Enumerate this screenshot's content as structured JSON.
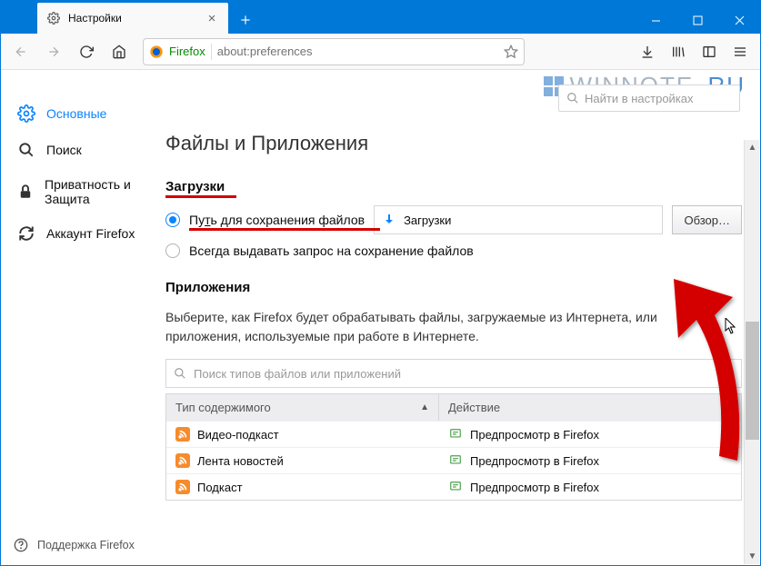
{
  "watermark": {
    "text1": "WINNOTE",
    "text2": ".RU"
  },
  "titlebar": {
    "tab_title": "Настройки",
    "tab_icon": "gear-icon",
    "close_icon": "close-icon",
    "newtab_icon": "plus-icon"
  },
  "window_controls": {
    "min": "—",
    "max": "▢",
    "close": "✕"
  },
  "toolbar": {
    "back": "back-icon",
    "fwd": "forward-icon",
    "reload": "reload-icon",
    "home": "home-icon",
    "url_label": "Firefox",
    "url_text": "about:preferences",
    "star": "star-icon",
    "downloads": "download-icon",
    "library": "library-icon",
    "sidebar": "sidebar-icon",
    "menu": "menu-icon"
  },
  "search": {
    "placeholder": "Найти в настройках",
    "icon": "search-icon"
  },
  "sidebar": {
    "items": [
      {
        "icon": "gear-icon",
        "label": "Основные",
        "active": true
      },
      {
        "icon": "search-icon",
        "label": "Поиск"
      },
      {
        "icon": "lock-icon",
        "label": "Приватность и Защита"
      },
      {
        "icon": "sync-icon",
        "label": "Аккаунт Firefox"
      }
    ],
    "support": {
      "icon": "help-icon",
      "label": "Поддержка Firefox"
    }
  },
  "main": {
    "heading": "Файлы и Приложения",
    "downloads": {
      "title": "Загрузки",
      "opt1_prefix": "Пу",
      "opt1_u": "т",
      "opt1_suffix": "ь для сохранения файлов",
      "path_label": "Загрузки",
      "browse": "Обзор…",
      "opt2": "Всегда выдавать запрос на сохранение файлов"
    },
    "apps": {
      "title": "Приложения",
      "desc": "Выберите, как Firefox будет обрабатывать файлы, загружаемые из Интернета, или приложения, используемые при работе в Интернете.",
      "filter_placeholder": "Поиск типов файлов или приложений",
      "col1": "Тип содержимого",
      "col2": "Действие",
      "rows": [
        {
          "type": "Видео-подкаст",
          "action": "Предпросмотр в Firefox"
        },
        {
          "type": "Лента новостей",
          "action": "Предпросмотр в Firefox"
        },
        {
          "type": "Подкаст",
          "action": "Предпросмотр в Firefox"
        }
      ]
    }
  }
}
